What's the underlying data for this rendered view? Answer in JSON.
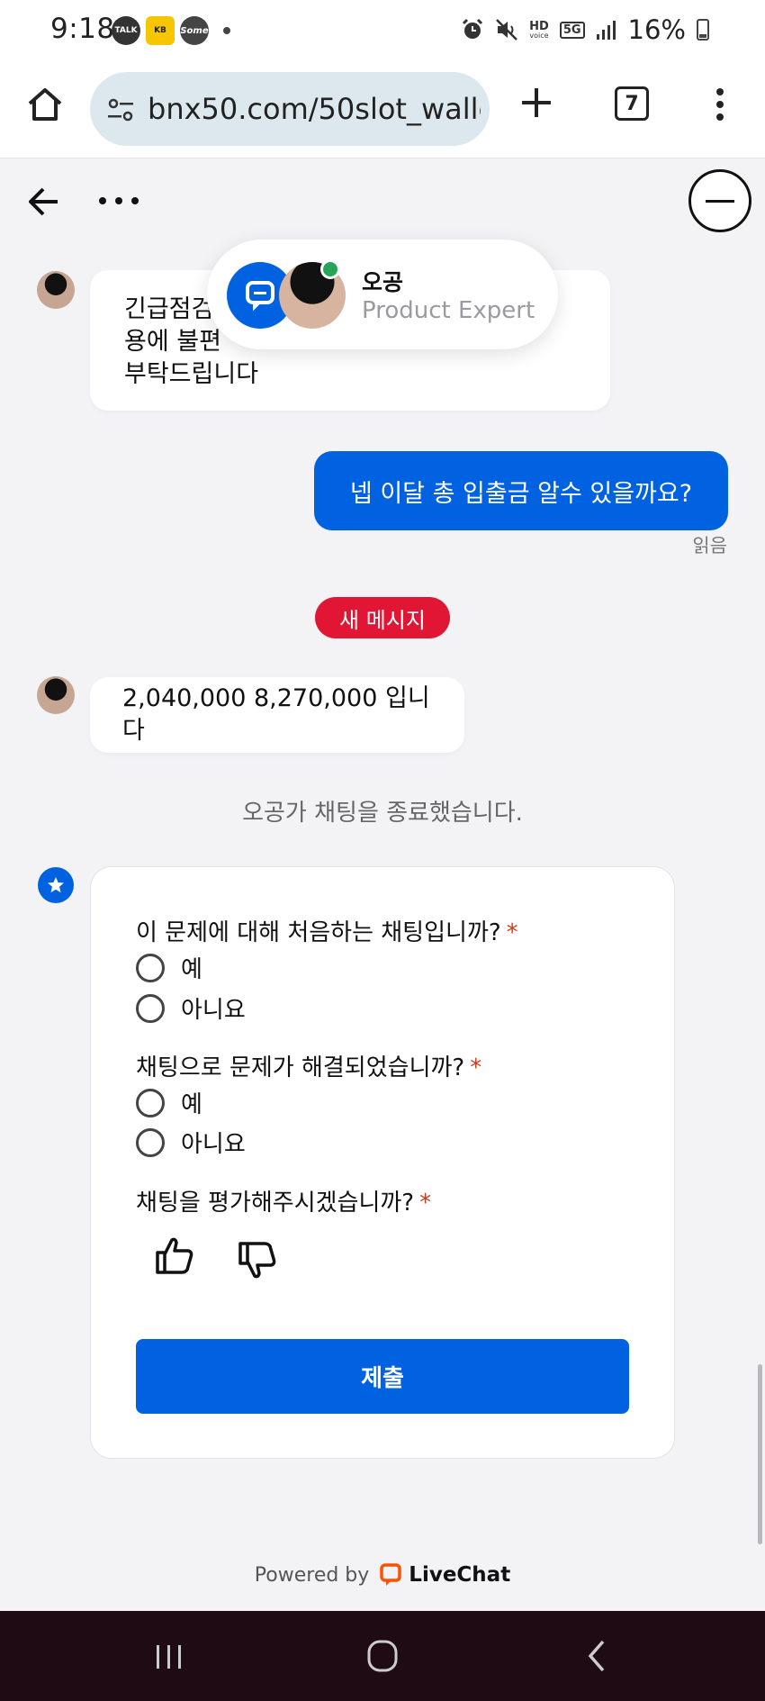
{
  "status": {
    "time": "9:18",
    "notif_talk": "TALK",
    "notif_kb": "KB",
    "notif_some": "Some",
    "hd_label": "HD",
    "voice_label": "voice",
    "net_label": "5G",
    "battery": "16%"
  },
  "browser": {
    "url": "bnx50.com/50slot_walle",
    "tab_count": "7"
  },
  "agent": {
    "name": "오공",
    "role": "Product Expert",
    "status_color": "#26a45a"
  },
  "messages": {
    "first_incoming": [
      "긴급점검",
      "용에 불편",
      "부탁드립니다"
    ],
    "outgoing": "넵 이달 총 입출금 알수 있을까요?",
    "read_receipt": "읽음",
    "new_message_badge": "새 메시지",
    "second_incoming": "2,040,000 8,270,000 입니다",
    "chat_ended": "오공가 채팅을 종료했습니다."
  },
  "survey": {
    "q1": "이 문제에 대해 처음하는 채팅입니까?",
    "q1_options": [
      "예",
      "아니요"
    ],
    "q2": "채팅으로 문제가 해결되었습니까?",
    "q2_options": [
      "예",
      "아니요"
    ],
    "q3": "채팅을 평가해주시겠습니까?",
    "required_mark": "*",
    "submit": "제출"
  },
  "footer": {
    "powered_by": "Powered by",
    "brand": "LiveChat",
    "brand_color": "#ff5100"
  },
  "colors": {
    "accent": "#0062e0",
    "badge_red": "#e11534"
  }
}
